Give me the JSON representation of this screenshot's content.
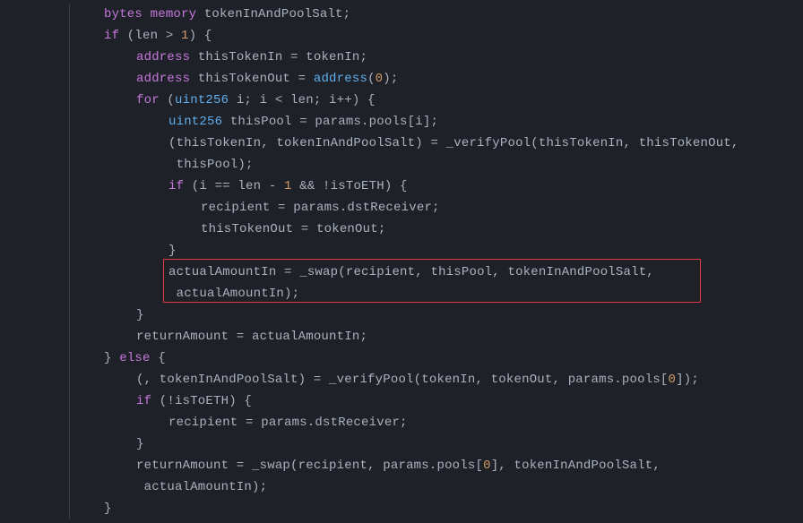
{
  "code": {
    "l1": {
      "kw": "bytes",
      "kw2": "memory",
      "rest": " tokenInAndPoolSalt;"
    },
    "l2": {
      "kw": "if",
      "pre": " (len ",
      "op": ">",
      "num": " 1",
      "post": ") {"
    },
    "l3": {
      "kw": "address",
      "rest": " thisTokenIn = tokenIn;"
    },
    "l4": {
      "kw": "address",
      "mid": " thisTokenOut = ",
      "fn": "address",
      "open": "(",
      "num": "0",
      "close": ");"
    },
    "l5": {
      "kw": "for",
      "open": " (",
      "type": "uint256",
      "rest": " i; i < len; i++) {"
    },
    "l6": {
      "type": "uint256",
      "mid": " thisPool = params.pools[",
      "idx": "i",
      "close": "];"
    },
    "l7": {
      "pre": "(thisTokenIn, tokenInAndPoolSalt) = ",
      "fn": "_verifyPool",
      "args": "(thisTokenIn, thisTokenOut,"
    },
    "l7b": {
      "rest": " thisPool);"
    },
    "l8": {
      "kw": "if",
      "pre": " (i == len - ",
      "num": "1",
      "mid": " && !isToETH) {"
    },
    "l9": {
      "rest": "recipient = params.dstReceiver;"
    },
    "l10": {
      "rest": "thisTokenOut = tokenOut;"
    },
    "l11": {
      "rest": "}"
    },
    "l12": {
      "pre": "actualAmountIn = ",
      "fn": "_swap",
      "args": "(recipient, thisPool, tokenInAndPoolSalt,"
    },
    "l12b": {
      "rest": " actualAmountIn);"
    },
    "l13": {
      "rest": "}"
    },
    "l14": {
      "rest": "returnAmount = actualAmountIn;"
    },
    "l15": {
      "pre": "} ",
      "kw": "else",
      "post": " {"
    },
    "l16": {
      "pre": "(, tokenInAndPoolSalt) = ",
      "fn": "_verifyPool",
      "mid": "(tokenIn, tokenOut, params.pools[",
      "num": "0",
      "close": "]);"
    },
    "l17": {
      "kw": "if",
      "rest": " (!isToETH) {"
    },
    "l18": {
      "rest": "recipient = params.dstReceiver;"
    },
    "l19": {
      "rest": "}"
    },
    "l20": {
      "pre": "returnAmount = ",
      "fn": "_swap",
      "mid": "(recipient, params.pools[",
      "num": "0",
      "close": "], tokenInAndPoolSalt,"
    },
    "l20b": {
      "rest": " actualAmountIn);"
    },
    "l21": {
      "rest": "}"
    }
  }
}
